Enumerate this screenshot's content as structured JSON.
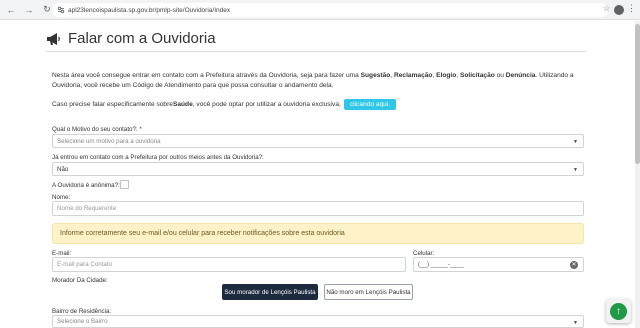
{
  "browser": {
    "url": "apl23lencoispaulista.sp.gov.br/pmlp-site/Ouvidoria/Index",
    "back": "←",
    "forward": "→",
    "reload": "↻",
    "star": "☆",
    "menu": "⋮"
  },
  "page": {
    "title": "Falar com a Ouvidoria",
    "intro_parts": [
      "Nesta área você consegue entrar em contato com a Prefeitura através da Ouvidoria, seja para fazer uma ",
      "Sugestão",
      ", ",
      "Reclamação",
      ", ",
      "Elogio",
      ", ",
      "Solicitação",
      " ou ",
      "Denúncia",
      ". Utilizando a Ouvidoria, você recebe um Código de Atendimento para que possa consultar o andamento dela."
    ],
    "health_prefix": "Caso precise falar especificamente sobre ",
    "health_bold": "Saúde",
    "health_suffix": ", você pode optar por utilizar a ouvidoria exclusiva,",
    "click_here": "clicando aqui."
  },
  "form": {
    "motivo_label": "Qual o Motivo do seu contato?: *",
    "motivo_placeholder": "Selecione um motivo para a ouvidoria",
    "previous_label": "Já entrou em contato com a Prefeitura por outros meios antes da Ouvidoria?:",
    "previous_value": "Não",
    "anon_label": "A Ouvidoria é anônima?:",
    "name_label": "Nome:",
    "name_placeholder": "Nome do Requerente",
    "alert": "Informe corretamente seu e-mail e/ou celular para receber notificações sobre esta ouvidoria",
    "email_label": "E-mail:",
    "email_placeholder": "E-mail para Contato",
    "cell_label": "Celular:",
    "cell_placeholder": "(__) _____-____",
    "resident_label": "Morador Da Cidade:",
    "resident_yes": "Sou morador de Lençóis Paulista",
    "resident_no": "Não moro em Lençóis Paulista",
    "bairro_label": "Bairro de Residência:",
    "bairro_placeholder": "Selecione o Bairro"
  },
  "fab": "↑"
}
